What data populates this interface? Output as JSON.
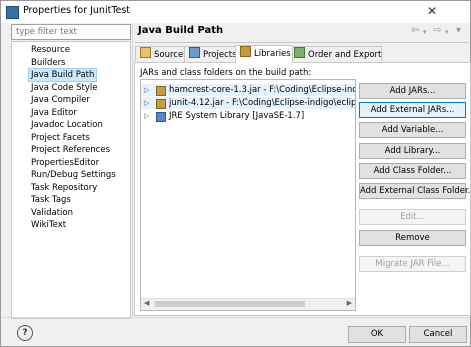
{
  "window": {
    "title": "Properties for JunitTest",
    "close_glyph": "✕"
  },
  "filter": {
    "placeholder": "type filter text"
  },
  "tree": {
    "items": [
      {
        "label": "Resource"
      },
      {
        "label": "Builders"
      },
      {
        "label": "Java Build Path",
        "selected": true
      },
      {
        "label": "Java Code Style"
      },
      {
        "label": "Java Compiler"
      },
      {
        "label": "Java Editor"
      },
      {
        "label": "Javadoc Location"
      },
      {
        "label": "Project Facets"
      },
      {
        "label": "Project References"
      },
      {
        "label": "PropertiesEditor"
      },
      {
        "label": "Run/Debug Settings"
      },
      {
        "label": "Task Repository"
      },
      {
        "label": "Task Tags"
      },
      {
        "label": "Validation"
      },
      {
        "label": "WikiText"
      }
    ]
  },
  "page": {
    "title": "Java Build Path"
  },
  "tabs": [
    {
      "label": "Source",
      "icon": "source-icon"
    },
    {
      "label": "Projects",
      "icon": "projects-icon"
    },
    {
      "label": "Libraries",
      "icon": "libraries-icon",
      "active": true
    },
    {
      "label": "Order and Export",
      "icon": "order-export-icon"
    }
  ],
  "libraries": {
    "label": "JARs and class folders on the build path:",
    "entries": [
      {
        "text": "hamcrest-core-1.3.jar - F:\\Coding\\Eclipse-indigo\\e",
        "icon": "jar-icon"
      },
      {
        "text": "junit-4.12.jar - F:\\Coding\\Eclipse-indigo\\eclipse\\dr",
        "icon": "jar-icon"
      },
      {
        "text": "JRE System Library [JavaSE-1.7]",
        "icon": "library-icon"
      }
    ]
  },
  "buttons": [
    {
      "label": "Add JARs...",
      "enabled": true
    },
    {
      "label": "Add External JARs...",
      "enabled": true,
      "focused": true
    },
    {
      "label": "Add Variable...",
      "enabled": true
    },
    {
      "label": "Add Library...",
      "enabled": true
    },
    {
      "label": "Add Class Folder...",
      "enabled": true
    },
    {
      "label": "Add External Class Folder...",
      "enabled": true
    },
    {
      "label": "Edit...",
      "enabled": false
    },
    {
      "label": "Remove",
      "enabled": true
    },
    {
      "label": "Migrate JAR File...",
      "enabled": false
    }
  ],
  "footer": {
    "help_glyph": "?",
    "ok_label": "OK",
    "cancel_label": "Cancel"
  }
}
